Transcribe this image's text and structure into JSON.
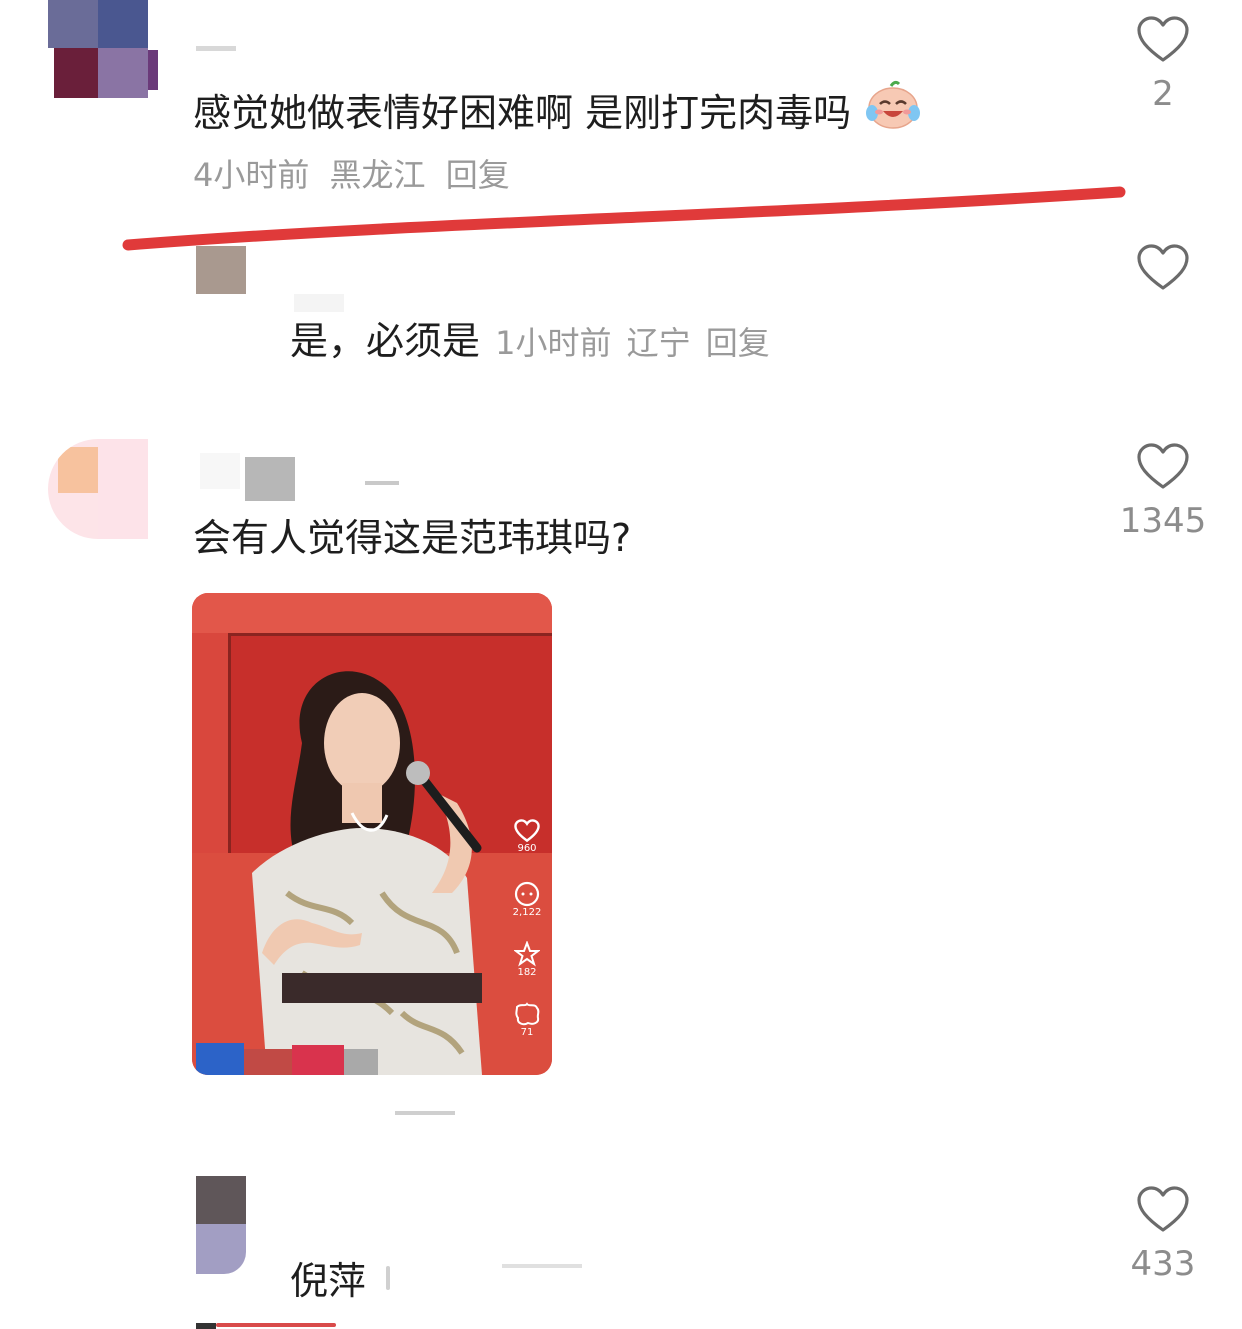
{
  "comments": [
    {
      "text": "感觉她做表情好困难啊 是刚打完肉毒吗",
      "emoji_icon": "crying-laughing-face-icon",
      "time": "4小时前",
      "location": "黑龙江",
      "reply_label": "回复",
      "likes": "2"
    },
    {
      "text": "是，必须是",
      "time": "1小时前",
      "location": "辽宁",
      "reply_label": "回复"
    },
    {
      "text": "会有人觉得这是范玮琪吗?",
      "likes": "1345",
      "image": {
        "side_stats": [
          "960",
          "2,122",
          "182",
          "71"
        ]
      }
    },
    {
      "text": "倪萍",
      "likes": "433"
    }
  ],
  "colors": {
    "annotation_line": "#e03a3a",
    "meta_text": "#9a9a9a",
    "like_count": "#8c8c8c"
  }
}
